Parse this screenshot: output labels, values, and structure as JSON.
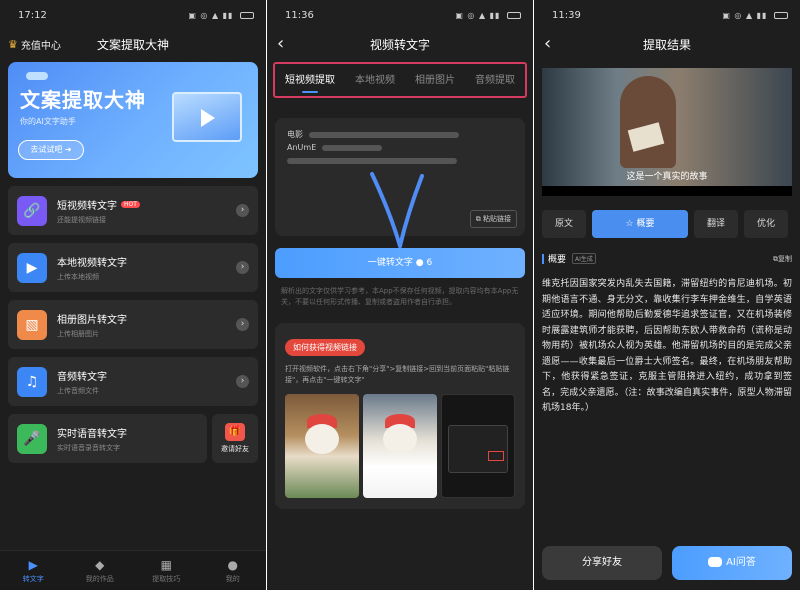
{
  "phone1": {
    "status_time": "17:12",
    "recharge_label": "充值中心",
    "app_title": "文案提取大神",
    "banner": {
      "title": "文案提取大神",
      "subtitle": "你的AI文字助手",
      "button": "去试试吧"
    },
    "menu": [
      {
        "title": "短视频转文字",
        "sub": "还能提视频链接",
        "badge": "HOT",
        "color": "#7a5af5"
      },
      {
        "title": "本地视频转文字",
        "sub": "上传本地视频",
        "color": "#3d86f5"
      },
      {
        "title": "相册图片转文字",
        "sub": "上传相册图片",
        "color": "#f08a4b"
      },
      {
        "title": "音频转文字",
        "sub": "上传音频文件",
        "color": "#3d86f5"
      },
      {
        "title": "实时语音转文字",
        "sub": "实时语音录音转文字",
        "color": "#3cba5b"
      }
    ],
    "invite_label": "邀请好友",
    "tabs": [
      "转文字",
      "我的作品",
      "提取技巧",
      "我的"
    ]
  },
  "phone2": {
    "status_time": "11:36",
    "title": "视频转文字",
    "tabs": [
      "短视频提取",
      "本地视频",
      "相册图片",
      "音频提取"
    ],
    "input_lines": [
      "电影",
      "AnUmE",
      ""
    ],
    "paste_label": "粘贴链接",
    "convert_label": "一键转文字",
    "convert_cost": "6",
    "disclaimer": "解析出的文字仅供学习参考，本App不保存任何视频，提取内容均有本App无关，不要以任何形式传播、复制或者盗用作者自行承担。",
    "guide_title": "如何获得视频链接",
    "guide_desc": "打开视频软件，点击右下角\"分享\">复制链接>回到当前页面粘贴\"粘贴链接\"，再点击\"一键转文字\""
  },
  "phone3": {
    "status_time": "11:39",
    "title": "提取结果",
    "video_subtitle": "这是一个真实的故事",
    "tabs": [
      "原文",
      "概要",
      "翻译",
      "优化"
    ],
    "summary_label": "概要",
    "ai_tag": "AI生成",
    "copy_label": "复制",
    "article": "维克托因国家突发内乱失去国籍，滞留纽约的肯尼迪机场。初期他语言不通、身无分文，靠收集行李车押金维生，自学英语适应环境。期间他帮助后勤爱德华追求签证官，又在机场装修时展露建筑师才能获聘，后因帮助东欧人带救命药（谎称是动物用药）被机场众人视为英雄。他滞留机场的目的是完成父亲遗愿——收集最后一位爵士大师签名。最终，在机场朋友帮助下，他获得紧急签证，克服主管阻挠进入纽约，成功拿到签名，完成父亲遗愿。（注：故事改编自真实事件，原型人物滞留机场18年。）",
    "share_label": "分享好友",
    "ai_label": "AI问答"
  }
}
